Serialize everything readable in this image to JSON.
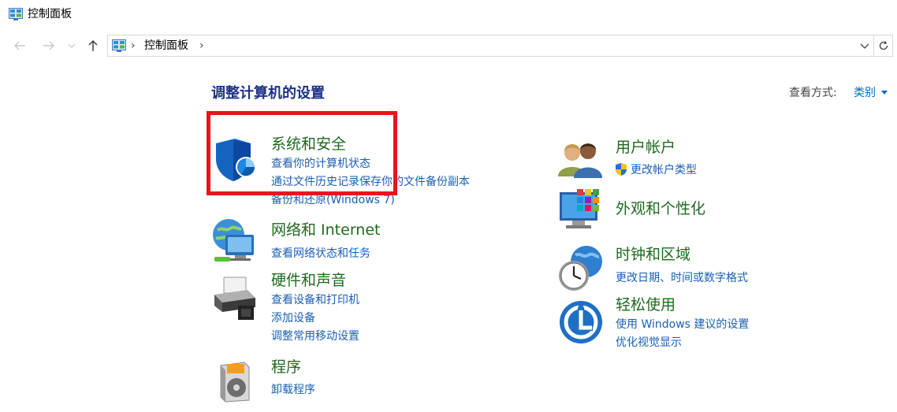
{
  "window": {
    "title": "控制面板",
    "icon": "control-panel-icon"
  },
  "nav": {
    "back_icon": "arrow-left-icon",
    "forward_icon": "arrow-right-icon",
    "recent_icon": "chevron-down-icon",
    "up_icon": "arrow-up-icon",
    "breadcrumb_sep": "›",
    "address": "控制面板",
    "refresh_icon": "refresh-icon"
  },
  "main": {
    "title": "调整计算机的设置",
    "view_by_label": "查看方式:",
    "view_by_value": "类别"
  },
  "categories": [
    {
      "title": "系统和安全",
      "icon": "shield-icon",
      "links": [
        "查看你的计算机状态",
        "通过文件历史记录保存你的文件备份副本",
        "备份和还原(Windows 7)"
      ]
    },
    {
      "title": "网络和 Internet",
      "icon": "network-globe-icon",
      "links": [
        "查看网络状态和任务"
      ]
    },
    {
      "title": "硬件和声音",
      "icon": "printer-icon",
      "links": [
        "查看设备和打印机",
        "添加设备",
        "调整常用移动设置"
      ]
    },
    {
      "title": "程序",
      "icon": "programs-disc-icon",
      "links": [
        "卸载程序"
      ]
    },
    {
      "title": "用户帐户",
      "icon": "users-icon",
      "links": [
        "更改帐户类型"
      ]
    },
    {
      "title": "外观和个性化",
      "icon": "monitor-colors-icon",
      "links": []
    },
    {
      "title": "时钟和区域",
      "icon": "clock-globe-icon",
      "links": [
        "更改日期、时间或数字格式"
      ]
    },
    {
      "title": "轻松使用",
      "icon": "ease-of-access-icon",
      "links": [
        "使用 Windows 建议的设置",
        "优化视觉显示"
      ]
    }
  ],
  "colors": {
    "accent_link": "#1a5fb4",
    "category_title": "#1d6a1d",
    "page_title": "#1e3287",
    "highlight": "#e8141c"
  }
}
